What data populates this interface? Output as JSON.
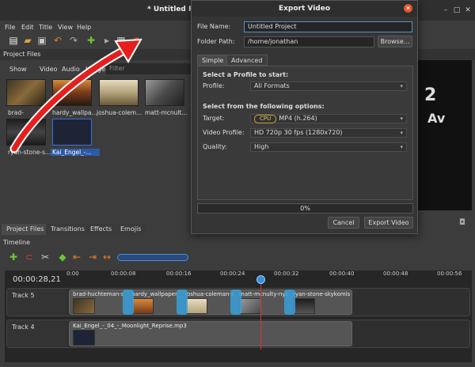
{
  "window": {
    "title": "* Untitled Proje"
  },
  "menu": {
    "items": [
      "File",
      "Edit",
      "Title",
      "View",
      "Help"
    ]
  },
  "project_files": {
    "header": "Project Files",
    "tabs": [
      "Show All",
      "Video",
      "Audio",
      "Image"
    ],
    "filter_placeholder": "Filter",
    "items": [
      {
        "name": "brad-",
        "color": "#6b5a3a"
      },
      {
        "name": "hardy_wallpa...",
        "color": "#a0652a"
      },
      {
        "name": "joshua-colem...",
        "color": "#b5a98a"
      },
      {
        "name": "matt-mcnult...",
        "color": "#7a7a7a"
      },
      {
        "name": "ryan-stone-s...",
        "color": "#2e2e2e"
      },
      {
        "name": "Kai_Engel_-...",
        "color": "#20253a"
      }
    ]
  },
  "bottom_tabs": [
    "Project Files",
    "Transitions",
    "Effects",
    "Emojis"
  ],
  "timeline": {
    "header": "Timeline",
    "time": "00:00:28,21",
    "ruler": [
      "0:00",
      "00:00:08",
      "00:00:16",
      "00:00:24",
      "00:00:32",
      "00:00:40",
      "00:00:48",
      "00:00:56"
    ],
    "tracks": [
      {
        "name": "Track 5",
        "clips": [
          "brad-huchteman-s",
          "hardy_wallpaper_",
          "joshua-coleman-s",
          "matt-mcnulty-nyc",
          "ryan-stone-skykomis"
        ]
      },
      {
        "name": "Track 4",
        "clips": [
          "Kai_Engel_-_04_-_Moonlight_Reprise.mp3"
        ]
      }
    ]
  },
  "preview": {
    "text_big": "2",
    "text_av": "Av"
  },
  "export_dialog": {
    "title": "Export Video",
    "file_name_label": "File Name:",
    "file_name": "Untitled Project",
    "folder_label": "Folder Path:",
    "folder_path": "/home/jonathan",
    "browse": "Browse...",
    "tabs": [
      "Simple",
      "Advanced"
    ],
    "section_profile": "Select a Profile to start:",
    "profile_label": "Profile:",
    "profile_value": "All Formats",
    "section_options": "Select from the following options:",
    "target_label": "Target:",
    "target_badge": "CPU",
    "target_value": "MP4 (h.264)",
    "video_profile_label": "Video Profile:",
    "video_profile_value": "HD 720p 30 fps (1280x720)",
    "quality_label": "Quality:",
    "quality_value": "High",
    "progress": "0%",
    "cancel": "Cancel",
    "export": "Export Video"
  }
}
